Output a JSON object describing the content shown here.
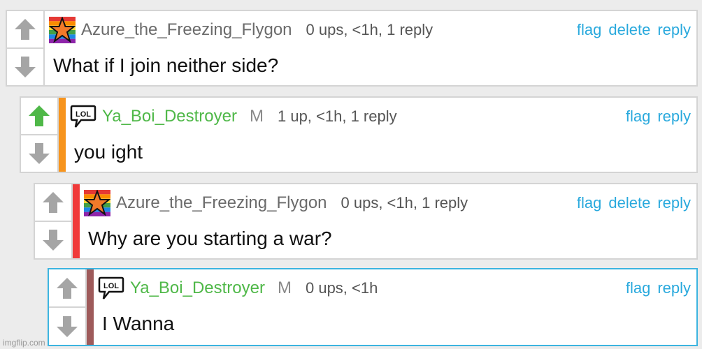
{
  "colors": {
    "accent_link": "#29a9dd",
    "upvoted_arrow": "#4fb848",
    "neutral_arrow": "#a5a5a5",
    "stripe_orange": "#f7941d",
    "stripe_red": "#f03a3a",
    "stripe_brown": "#9e5a5a",
    "selected_border": "#3cb4e0"
  },
  "comments": [
    {
      "user": "Azure_the_Freezing_Flygon",
      "badge": "",
      "meta": "0 ups, <1h, 1 reply",
      "text": "What if I join neither side?",
      "actions": [
        "flag",
        "delete",
        "reply"
      ],
      "avatar_icon": "rainbow-star-icon",
      "upvoted": false
    },
    {
      "user": "Ya_Boi_Destroyer",
      "badge": "M",
      "meta": "1 up, <1h, 1 reply",
      "text": "you ight",
      "actions": [
        "flag",
        "reply"
      ],
      "avatar_icon": "lol-speech-bubble-icon",
      "upvoted": true
    },
    {
      "user": "Azure_the_Freezing_Flygon",
      "badge": "",
      "meta": "0 ups, <1h, 1 reply",
      "text": "Why are you starting a war?",
      "actions": [
        "flag",
        "delete",
        "reply"
      ],
      "avatar_icon": "rainbow-star-icon",
      "upvoted": false
    },
    {
      "user": "Ya_Boi_Destroyer",
      "badge": "M",
      "meta": "0 ups, <1h",
      "text": "I Wanna",
      "actions": [
        "flag",
        "reply"
      ],
      "avatar_icon": "lol-speech-bubble-icon",
      "upvoted": false
    }
  ],
  "watermark": "imgflip.com"
}
